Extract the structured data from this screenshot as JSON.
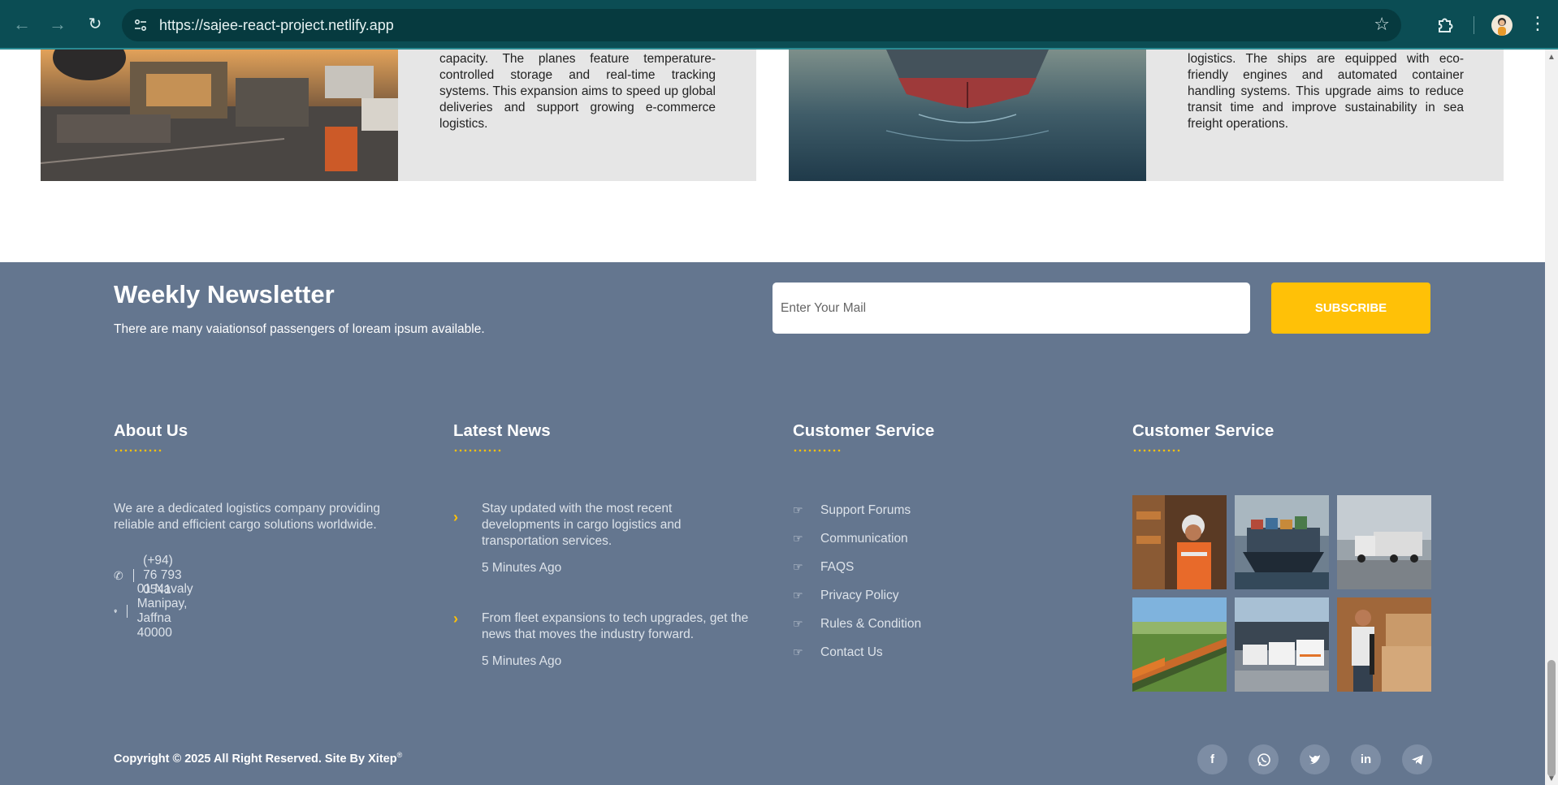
{
  "browser": {
    "url": "https://sajee-react-project.netlify.app",
    "back_icon": "arrow-left-icon",
    "forward_icon": "arrow-right-icon",
    "reload_icon": "reload-icon",
    "bookmark_icon": "star-icon",
    "extensions_icon": "puzzle-icon",
    "menu_icon": "kebab-menu-icon"
  },
  "cards": [
    {
      "image": "airport-cargo-loading",
      "text": "capacity. The planes feature temperature-controlled storage and real-time tracking systems. This expansion aims to speed up global deliveries and support growing e-commerce logistics."
    },
    {
      "image": "cargo-ship-bow-at-sea",
      "text": "logistics. The ships are equipped with eco-friendly engines and automated container handling systems. This upgrade aims to reduce transit time and improve sustainability in sea freight operations."
    }
  ],
  "newsletter": {
    "title": "Weekly Newsletter",
    "subtitle": "There are many vaiationsof passengers of loream ipsum available.",
    "input_placeholder": "Enter Your Mail",
    "button_label": "SUBSCRIBE"
  },
  "about": {
    "heading": "About Us",
    "text": "We are a dedicated logistics company providing reliable and efficient cargo solutions worldwide.",
    "phone": "(+94) 76 793 0541",
    "address": "01 Navaly Manipay, Jaffna 40000"
  },
  "news": {
    "heading": "Latest News",
    "items": [
      {
        "text": "Stay updated with the most recent developments in cargo logistics and transportation services.",
        "time": "5 Minutes Ago"
      },
      {
        "text": "From fleet expansions to tech upgrades, get the news that moves the industry forward.",
        "time": "5 Minutes Ago"
      }
    ]
  },
  "service": {
    "heading": "Customer Service",
    "links": [
      "Support Forums",
      "Communication",
      "FAQS",
      "Privacy Policy",
      "Rules & Condition",
      "Contact Us"
    ]
  },
  "gallery": {
    "heading": "Customer Service",
    "images": [
      "warehouse-worker",
      "container-ship",
      "truck-on-road",
      "freight-train",
      "delivery-vans",
      "worker-with-boxes"
    ]
  },
  "footer": {
    "copyright": "Copyright © 2025 All Right Reserved. Site By Xitep",
    "trademark": "®",
    "social": [
      "facebook-icon",
      "whatsapp-icon",
      "twitter-icon",
      "linkedin-icon",
      "telegram-icon"
    ]
  },
  "colors": {
    "footer_bg": "#64768f",
    "accent": "#ffc107",
    "card_bg": "#e6e6e6",
    "chrome_bg": "#0b4d54"
  }
}
